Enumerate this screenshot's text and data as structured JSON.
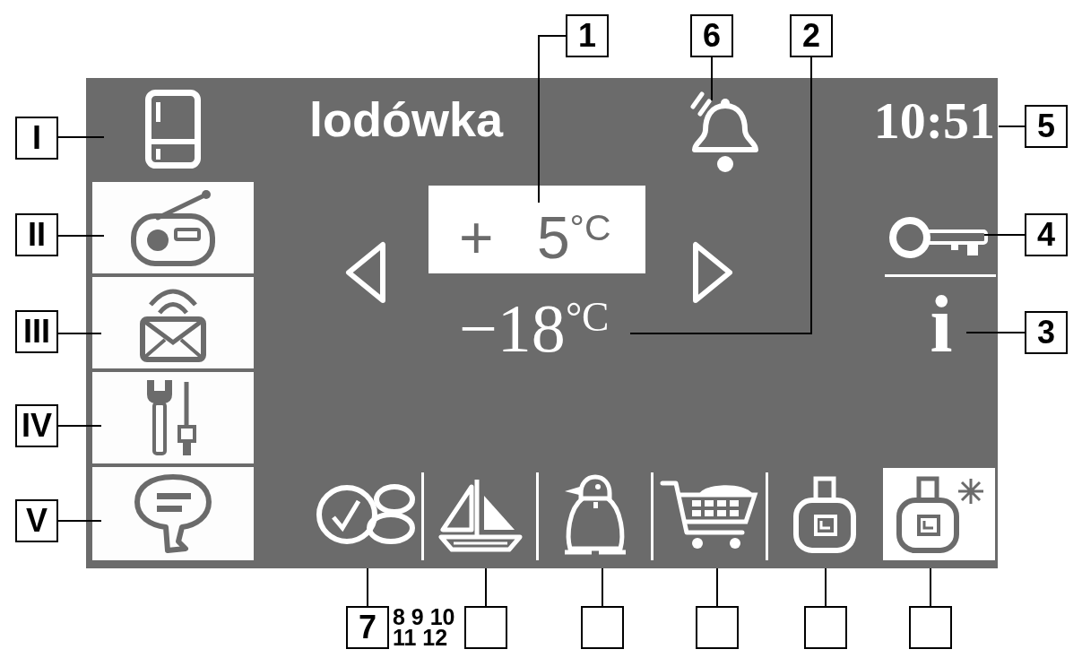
{
  "panel": {
    "title": "lodówka",
    "alarm": {
      "callout": "6"
    },
    "time": {
      "text": "10:51",
      "callout": "5"
    },
    "fridge_setting": {
      "text": "+ 5$^{°C}$",
      "callout": "1"
    },
    "freezer_reading": {
      "text": "−18$^{°C}$",
      "callout": "2"
    },
    "lock": {
      "callout": "4"
    },
    "info": {
      "symbol": "i",
      "callout": "3"
    }
  },
  "sidebar": {
    "items": [
      {
        "kind": "fridge",
        "selected": true,
        "callout": "I"
      },
      {
        "kind": "radio",
        "selected": false,
        "callout": "II"
      },
      {
        "kind": "mail",
        "selected": false,
        "callout": "III"
      },
      {
        "kind": "tools",
        "selected": false,
        "callout": "IV"
      },
      {
        "kind": "chat",
        "selected": false,
        "callout": "V"
      }
    ]
  },
  "bottom_bar": {
    "items": [
      {
        "kind": "coins",
        "selected": false,
        "callout": "7"
      },
      {
        "kind": "sailboat",
        "selected": false
      },
      {
        "kind": "penguin",
        "selected": false
      },
      {
        "kind": "cart",
        "selected": false
      },
      {
        "kind": "bottle",
        "selected": false
      },
      {
        "kind": "frostbottle",
        "selected": true
      }
    ],
    "extra_numbers": "8 9 10 11 12"
  }
}
